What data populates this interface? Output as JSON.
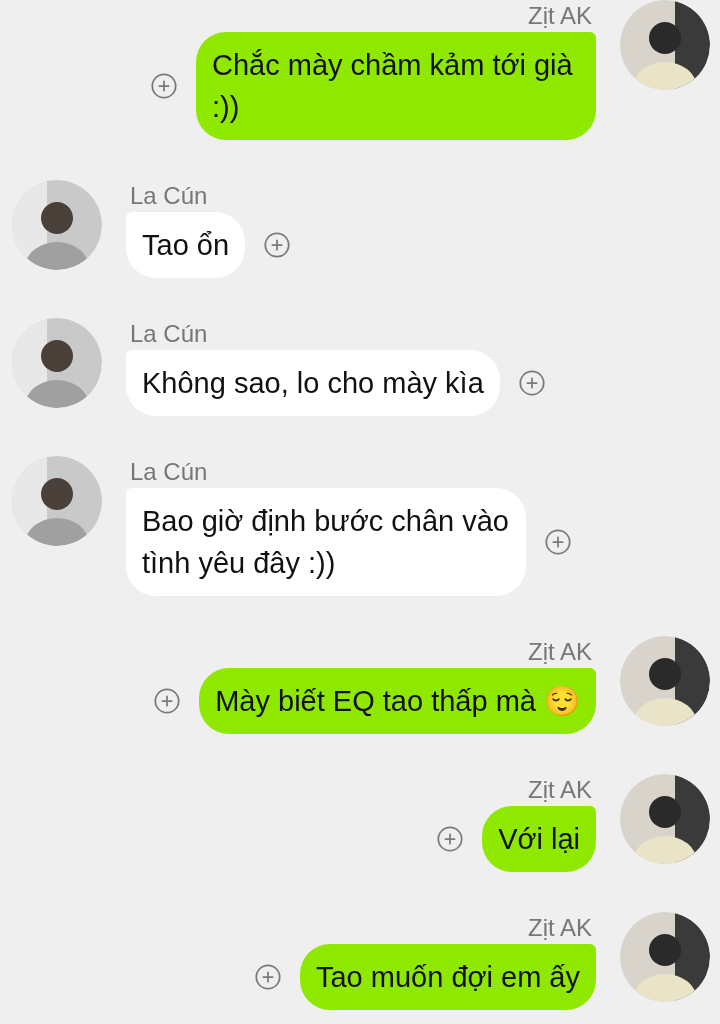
{
  "messages": [
    {
      "kind": "outgoing",
      "sender": "Zịt AK",
      "text": "Chắc mày chầm kảm tới già :))"
    },
    {
      "kind": "incoming",
      "sender": "La Cún",
      "text": "Tao ổn"
    },
    {
      "kind": "incoming",
      "sender": "La Cún",
      "text": "Không sao, lo cho mày kìa"
    },
    {
      "kind": "incoming",
      "sender": "La Cún",
      "text": "Bao giờ định bước chân vào tình yêu đây :))"
    },
    {
      "kind": "outgoing",
      "sender": "Zịt AK",
      "text": "Mày biết EQ tao thấp mà 😌"
    },
    {
      "kind": "outgoing",
      "sender": "Zịt AK",
      "text": "Với lại"
    },
    {
      "kind": "outgoing",
      "sender": "Zịt AK",
      "text": "Tao muốn đợi em ấy"
    }
  ]
}
